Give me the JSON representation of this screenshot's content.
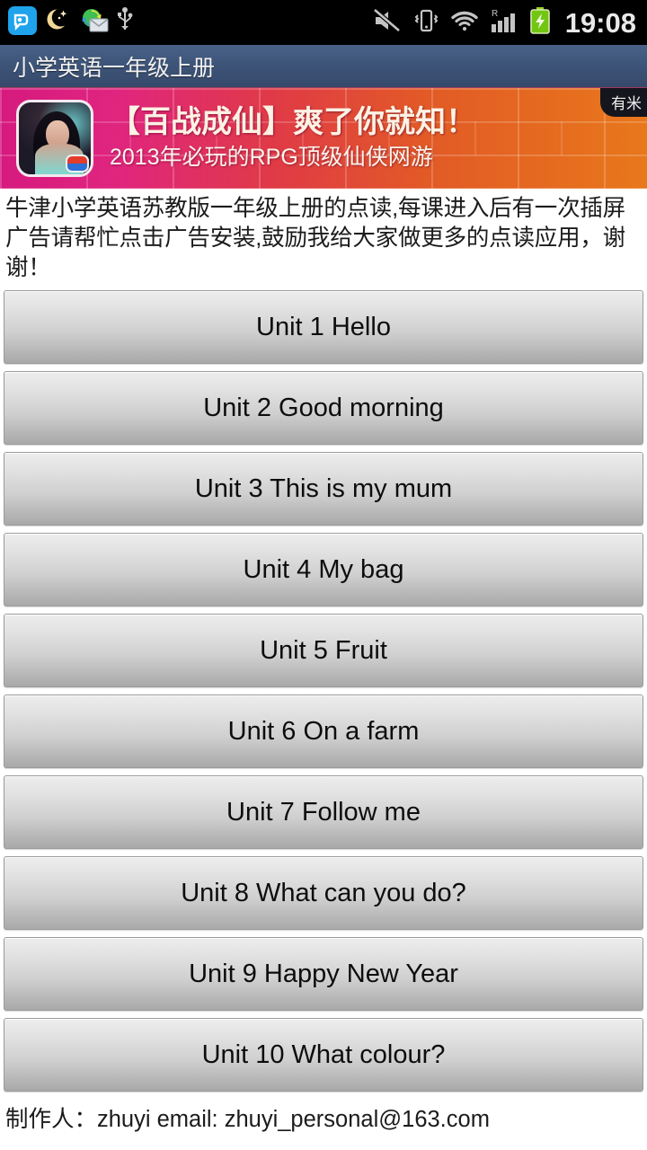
{
  "statusbar": {
    "time": "19:08",
    "left_icons": [
      {
        "name": "app-notification-icon",
        "label": "app"
      },
      {
        "name": "night-mode-icon",
        "label": "night mode"
      },
      {
        "name": "mail-sync-icon",
        "label": "mail sync"
      },
      {
        "name": "usb-icon",
        "label": "usb connected"
      }
    ],
    "right_icons": [
      {
        "name": "silent-mode-icon",
        "label": "silent"
      },
      {
        "name": "vibrate-mode-icon",
        "label": "vibrate"
      },
      {
        "name": "wifi-icon",
        "label": "wifi"
      },
      {
        "name": "cellular-signal-icon",
        "label": "signal",
        "roaming_label": "R"
      },
      {
        "name": "battery-charging-icon",
        "label": "battery charging"
      }
    ]
  },
  "titlebar": {
    "title": "小学英语一年级上册"
  },
  "ad": {
    "headline": "【百战成仙】爽了你就知！",
    "subline": "2013年必玩的RPG顶级仙侠网游",
    "network_tag": "有米"
  },
  "description": {
    "text": "牛津小学英语苏教版一年级上册的点读,每课进入后有一次插屏广告请帮忙点击广告安装,鼓励我给大家做更多的点读应用，谢谢！"
  },
  "units": [
    {
      "label": "Unit 1 Hello"
    },
    {
      "label": "Unit 2 Good morning"
    },
    {
      "label": "Unit 3 This is my mum"
    },
    {
      "label": "Unit 4 My bag"
    },
    {
      "label": "Unit 5 Fruit"
    },
    {
      "label": "Unit 6 On a farm"
    },
    {
      "label": "Unit 7 Follow me"
    },
    {
      "label": "Unit 8 What can you do?"
    },
    {
      "label": "Unit 9 Happy New Year"
    },
    {
      "label": "Unit 10 What colour?"
    }
  ],
  "footer": {
    "text": "制作人：zhuyi  email: zhuyi_personal@163.com"
  },
  "colors": {
    "titlebar": "#3d5579",
    "ad_gradient_start": "#d61a7f",
    "ad_gradient_end": "#e8781b",
    "battery": "#72c611",
    "page_background": "#ffffff"
  }
}
